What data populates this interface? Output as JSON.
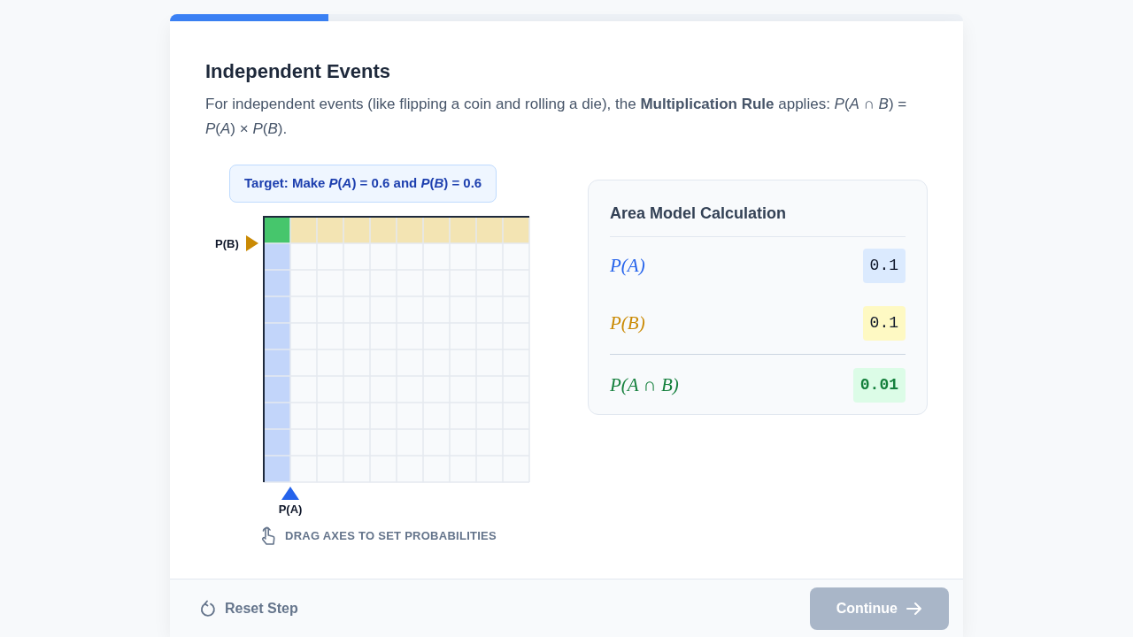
{
  "progress": {
    "level": 0.2
  },
  "title": "Independent Events",
  "intro": "For independent events (like flipping a coin and rolling a die), the **Multiplication Rule** applies: *P*(*A* ∩ *B*) = *P*(*A*) × *P*(*B*).",
  "target": "Target: Make *P*(*A*) = 0.6 and *P*(*B*) = 0.6",
  "area_model": {
    "a_label": "P(A)",
    "b_label": "P(B)"
  },
  "hint": "DRAG AXES TO SET PROBABILITIES",
  "calculation": {
    "title": "Area Model Calculation",
    "rows": [
      {
        "kind": "a",
        "label": "P(A)",
        "value": "0.1"
      },
      {
        "kind": "b",
        "label": "P(B)",
        "value": "0.1"
      },
      {
        "kind": "joint",
        "label": "P(A ∩ B)",
        "value": "0.01"
      }
    ]
  },
  "footer": {
    "reset": "Reset Step",
    "continue": {
      "label": "Continue",
      "disabled": true
    }
  }
}
